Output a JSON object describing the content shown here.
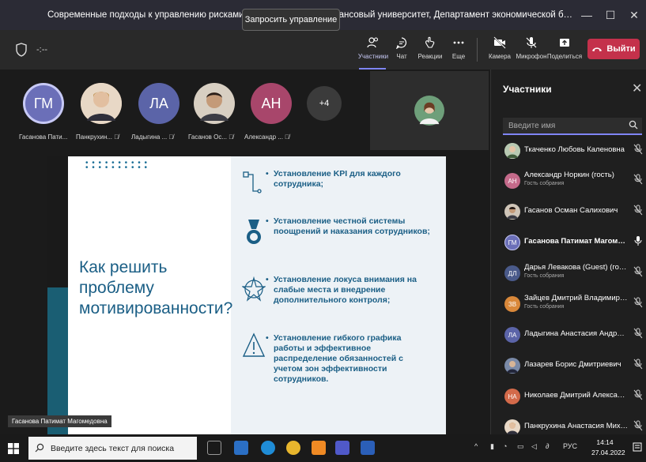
{
  "window": {
    "title": "Современные подходы к управлению рисками в организациях» (Финансовый университет, Департамент экономической безопасности и управления р...",
    "minimize": "—",
    "maximize": "☐",
    "close": "✕"
  },
  "toolbar": {
    "timer": "-:--",
    "request_control": "Запросить управление",
    "tools": [
      {
        "label": "Участники",
        "icon": "participants-icon"
      },
      {
        "label": "Чат",
        "icon": "chat-icon"
      },
      {
        "label": "Реакции",
        "icon": "reactions-icon"
      },
      {
        "label": "Еще",
        "icon": "more-icon"
      },
      {
        "label": "Камера",
        "icon": "camera-off-icon"
      },
      {
        "label": "Микрофон",
        "icon": "mic-off-icon"
      },
      {
        "label": "Поделиться",
        "icon": "share-icon"
      }
    ],
    "leave": "Выйти",
    "accent": "#7f85f5",
    "leave_color": "#c4314b"
  },
  "stage": {
    "participants": [
      {
        "initials": "ГМ",
        "name": "Гасанова Пати...",
        "color": "#6b6fb8"
      },
      {
        "initials": "",
        "name": "Панкрухин...",
        "color": "#c9a88a"
      },
      {
        "initials": "ЛА",
        "name": "Ладыгина ...",
        "color": "#5b64a8"
      },
      {
        "initials": "",
        "name": "Гасанов Ос...",
        "color": "#8b6a50"
      },
      {
        "initials": "АН",
        "name": "Александр ...",
        "color": "#a8466b"
      }
    ],
    "more_count": "+4",
    "presenter_badge": "Гасанова Патимат Магомедовна"
  },
  "slide": {
    "heading": "Как решить проблему мотивированности?",
    "bullets": [
      "Установление KPI для каждого сотрудника;",
      "Установление честной системы поощрений и наказания сотрудников;",
      "Установление локуса внимания на слабые места и внедрение дополнительного контроля;",
      "Установление гибкого графика работы и эффективное распределение обязанностей с учетом зон эффективности сотрудников."
    ],
    "accent": "#1a5e85"
  },
  "panel": {
    "title": "Участники",
    "search_placeholder": "Введите имя",
    "people": [
      {
        "initials": "",
        "name": "Ткаченко Любовь Каленовна",
        "sub": "",
        "color": "#8aa08a",
        "mic": "off"
      },
      {
        "initials": "АН",
        "name": "Александр Норкин (гость)",
        "sub": "Гость собрания",
        "color": "#c46a8a",
        "mic": "off"
      },
      {
        "initials": "",
        "name": "Гасанов Осман Салихович",
        "sub": "",
        "color": "#8b6a50",
        "mic": "off"
      },
      {
        "initials": "ГМ",
        "name": "Гасанова Патимат Магомедов...",
        "sub": "",
        "color": "#6b6fb8",
        "mic": "on"
      },
      {
        "initials": "ДЛ",
        "name": "Дарья Левакова (Guest) (гость)",
        "sub": "Гость собрания",
        "color": "#4a5a8a",
        "mic": "off"
      },
      {
        "initials": "ЗВ",
        "name": "Зайцев Дмитрий Владимирови...",
        "sub": "Гость собрания",
        "color": "#d9883a",
        "mic": "off"
      },
      {
        "initials": "ЛА",
        "name": "Ладыгина Анастасия Андреевна",
        "sub": "",
        "color": "#5b64a8",
        "mic": "off"
      },
      {
        "initials": "",
        "name": "Лазарев Борис Дмитриевич",
        "sub": "",
        "color": "#6a7a9a",
        "mic": "off"
      },
      {
        "initials": "НА",
        "name": "Николаев Дмитрий Александр...",
        "sub": "",
        "color": "#d36a4a",
        "mic": "off"
      },
      {
        "initials": "",
        "name": "Панкрухина Анастасия Михайл...",
        "sub": "",
        "color": "#c9a88a",
        "mic": "off"
      }
    ]
  },
  "taskbar": {
    "search_placeholder": "Введите здесь текст для поиска",
    "lang": "РУС",
    "time": "14:14",
    "date": "27.04.2022"
  }
}
